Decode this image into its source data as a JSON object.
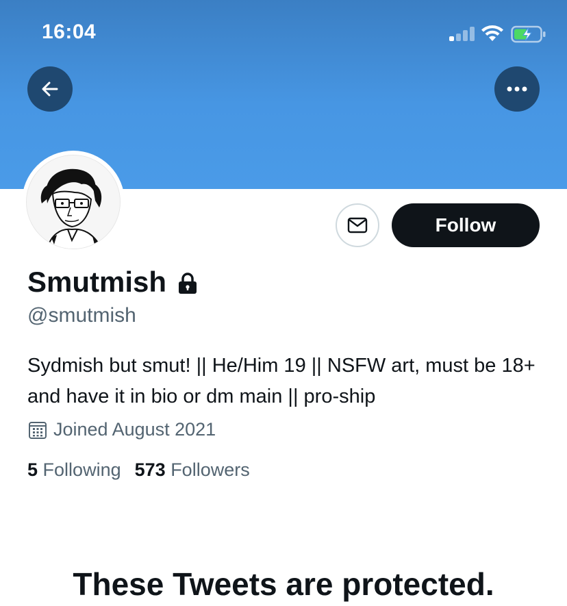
{
  "status_bar": {
    "time": "16:04",
    "icons": [
      "cellular-signal-icon",
      "wifi-icon",
      "battery-charging-icon"
    ]
  },
  "nav": {
    "back_icon": "arrow-left-icon",
    "more_icon": "more-horizontal-icon"
  },
  "profile": {
    "display_name": "Smutmish",
    "handle": "@smutmish",
    "bio": "Sydmish but smut! || He/Him 19 || NSFW art, must be 18+ and have it in bio or dm main || pro-ship",
    "joined": "Joined August 2021",
    "following_count": "5",
    "following_label": "Following",
    "followers_count": "573",
    "followers_label": "Followers"
  },
  "actions": {
    "message_icon": "envelope-icon",
    "follow_label": "Follow"
  },
  "notice": {
    "protected_title": "These Tweets are protected."
  },
  "colors": {
    "banner": "#4a9be8",
    "nav_button": "#1f4870",
    "follow_button": "#0f1419",
    "secondary_text": "#536471",
    "battery_green": "#4cd964"
  }
}
